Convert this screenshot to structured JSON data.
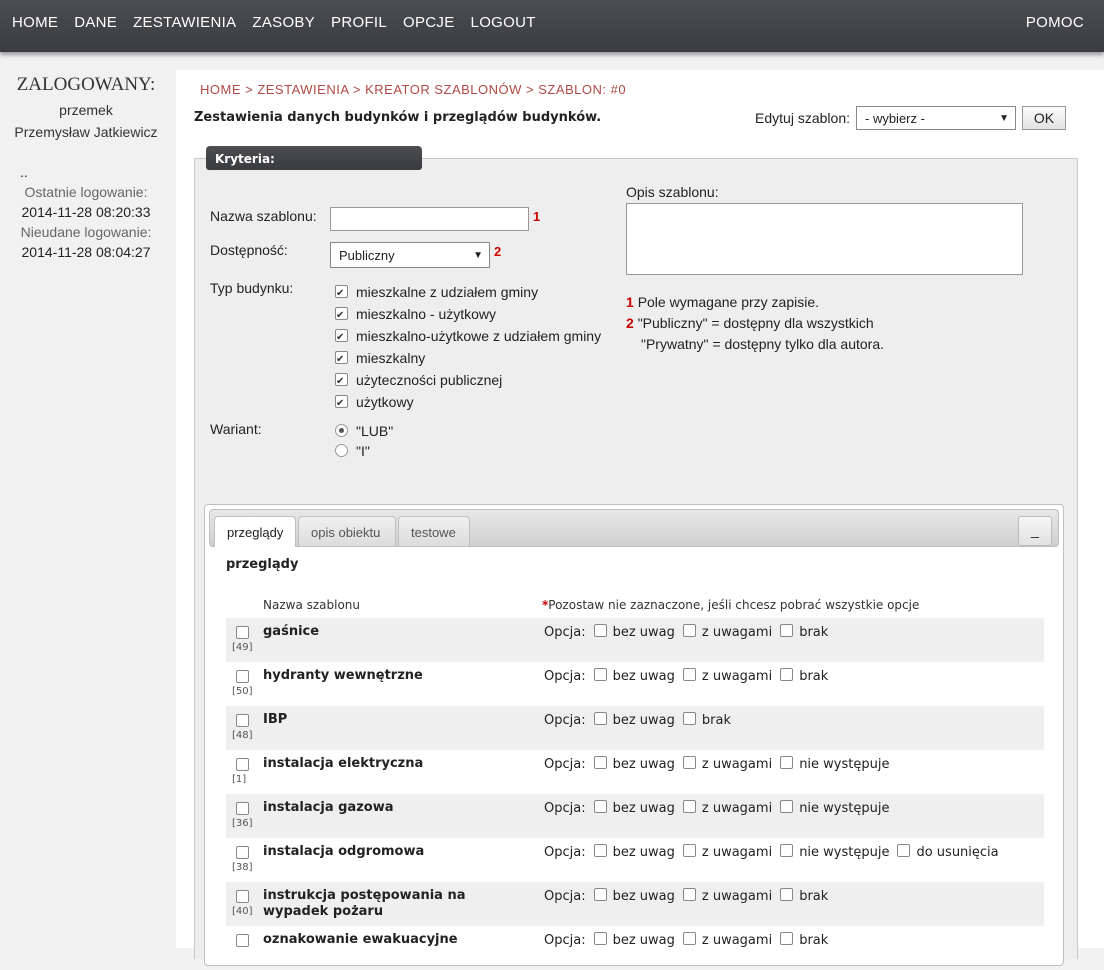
{
  "nav": {
    "items": [
      "HOME",
      "DANE",
      "ZESTAWIENIA",
      "ZASOBY",
      "PROFIL",
      "OPCJE",
      "LOGOUT"
    ],
    "help": "POMOC"
  },
  "sidebar": {
    "logged_label": "ZALOGOWANY:",
    "username": "przemek",
    "fullname": "Przemysław Jatkiewicz",
    "dots": "..",
    "last_login_label": "Ostatnie logowanie:",
    "last_login": "2014-11-28 08:20:33",
    "failed_login_label": "Nieudane logowanie:",
    "failed_login": "2014-11-28 08:04:27"
  },
  "breadcrumb": "HOME > ZESTAWIENIA > KREATOR SZABLONÓW > SZABLON: #0",
  "page_title": "Zestawienia danych budynków i przeglądów budynków.",
  "edit": {
    "label": "Edytuj szablon:",
    "selected": "- wybierz -",
    "ok": "OK"
  },
  "criteria": {
    "tab": "Kryteria:",
    "name_label": "Nazwa szablonu:",
    "name_value": "",
    "name_req": "1",
    "access_label": "Dostępność:",
    "access_value": "Publiczny",
    "access_req": "2",
    "type_label": "Typ budynku:",
    "types": [
      {
        "label": "mieszkalne z udziałem gminy",
        "checked": true
      },
      {
        "label": "mieszkalno - użytkowy",
        "checked": true
      },
      {
        "label": "mieszkalno-użytkowe z udziałem gminy",
        "checked": true
      },
      {
        "label": "mieszkalny",
        "checked": true
      },
      {
        "label": "użyteczności publicznej",
        "checked": true
      },
      {
        "label": "użytkowy",
        "checked": true
      }
    ],
    "variant_label": "Wariant:",
    "variants": [
      {
        "label": "\"LUB\"",
        "selected": true
      },
      {
        "label": "\"I\"",
        "selected": false
      }
    ],
    "desc_label": "Opis szablonu:",
    "desc_value": "",
    "notes": {
      "n1": "1",
      "t1": "Pole wymagane przy zapisie.",
      "n2": "2",
      "t2": "\"Publiczny\" = dostępny dla wszystkich",
      "t3": "\"Prywatny\" = dostępny tylko dla autora."
    }
  },
  "tabs": {
    "items": [
      "przeglądy",
      "opis obiektu",
      "testowe"
    ],
    "minimize": "_"
  },
  "section": {
    "title": "przeglądy",
    "col_name": "Nazwa szablonu",
    "col_note_star": "*",
    "col_note": "Pozostaw nie zaznaczone, jeśli chcesz pobrać wszystkie opcje",
    "option_label": "Opcja:",
    "rows": [
      {
        "id": "[49]",
        "name": "gaśnice",
        "options": [
          "bez uwag",
          "z uwagami",
          "brak"
        ]
      },
      {
        "id": "[50]",
        "name": "hydranty wewnętrzne",
        "options": [
          "bez uwag",
          "z uwagami",
          "brak"
        ]
      },
      {
        "id": "[48]",
        "name": "IBP",
        "options": [
          "bez uwag",
          "brak"
        ]
      },
      {
        "id": "[1]",
        "name": "instalacja elektryczna",
        "options": [
          "bez uwag",
          "z uwagami",
          "nie występuje"
        ]
      },
      {
        "id": "[36]",
        "name": "instalacja gazowa",
        "options": [
          "bez uwag",
          "z uwagami",
          "nie występuje"
        ]
      },
      {
        "id": "[38]",
        "name": "instalacja odgromowa",
        "options": [
          "bez uwag",
          "z uwagami",
          "nie występuje",
          "do usunięcia"
        ]
      },
      {
        "id": "[40]",
        "name": "instrukcja postępowania na wypadek pożaru",
        "options": [
          "bez uwag",
          "z uwagami",
          "brak"
        ]
      },
      {
        "id": "",
        "name": "oznakowanie ewakuacyjne",
        "options": [
          "bez uwag",
          "z uwagami",
          "brak"
        ]
      }
    ]
  }
}
